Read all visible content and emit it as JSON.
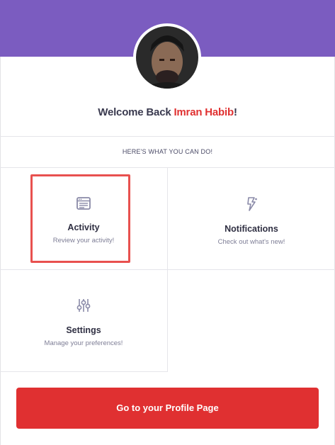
{
  "welcome": {
    "prefix": "Welcome Back",
    "name": "Imran Habib",
    "suffix": "!"
  },
  "intro": "HERE'S WHAT YOU CAN DO!",
  "tiles": [
    {
      "icon": "browser-window-icon",
      "title": "Activity",
      "subtitle": "Review your activity!"
    },
    {
      "icon": "lightning-bolt-icon",
      "title": "Notifications",
      "subtitle": "Check out what's new!"
    },
    {
      "icon": "sliders-icon",
      "title": "Settings",
      "subtitle": "Manage your preferences!"
    }
  ],
  "profile_button": "Go to your Profile Page",
  "colors": {
    "banner": "#7b5cc0",
    "accent_red": "#e03031",
    "highlight_border": "#e8514f",
    "icon": "#8a8aa8"
  }
}
